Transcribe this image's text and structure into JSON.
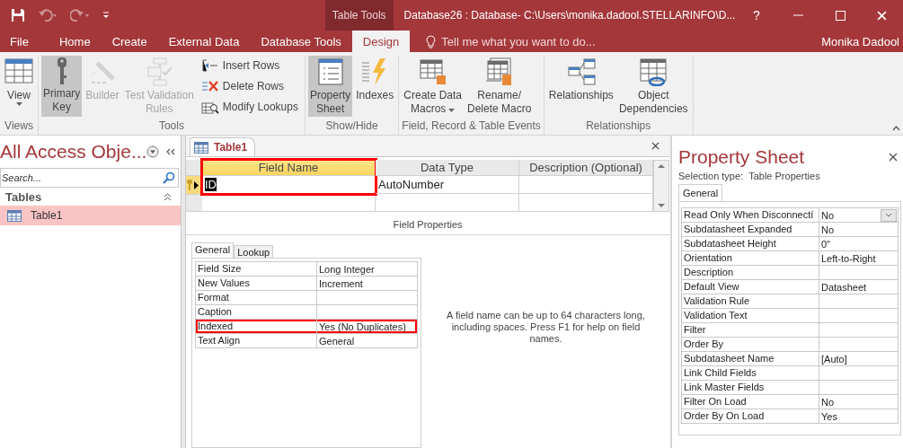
{
  "title_bar": {
    "context_tab": "Table Tools",
    "title": "Database26 : Database- C:\\Users\\monika.dadool.STELLARINFO\\D...",
    "help": "?"
  },
  "ribbon_tabs": [
    {
      "label": "File",
      "selected": false
    },
    {
      "label": "Home",
      "selected": false
    },
    {
      "label": "Create",
      "selected": false
    },
    {
      "label": "External Data",
      "selected": false
    },
    {
      "label": "Database Tools",
      "selected": false
    },
    {
      "label": "Design",
      "selected": true
    }
  ],
  "tell_me": {
    "placeholder": "Tell me what you want to do..."
  },
  "user": "Monika Dadool",
  "ribbon_groups": [
    {
      "label": "Views",
      "buttons": [
        {
          "kind": "large",
          "label": "View",
          "dropdown": true,
          "selected": false,
          "disabled": false
        }
      ]
    },
    {
      "label": "Tools",
      "buttons": [
        {
          "kind": "large",
          "label": "Primary\nKey",
          "dropdown": false,
          "selected": true,
          "disabled": false
        },
        {
          "kind": "large",
          "label": "Builder",
          "dropdown": false,
          "selected": false,
          "disabled": true
        },
        {
          "kind": "large",
          "label": "Test Validation\nRules",
          "dropdown": false,
          "selected": false,
          "disabled": true
        },
        {
          "kind": "small",
          "label": "Insert Rows",
          "disabled": false
        },
        {
          "kind": "small",
          "label": "Delete Rows",
          "disabled": false
        },
        {
          "kind": "small",
          "label": "Modify Lookups",
          "disabled": false
        }
      ]
    },
    {
      "label": "Show/Hide",
      "buttons": [
        {
          "kind": "large",
          "label": "Property\nSheet",
          "dropdown": false,
          "selected": true,
          "disabled": false
        },
        {
          "kind": "large",
          "label": "Indexes",
          "dropdown": false,
          "selected": false,
          "disabled": false
        }
      ]
    },
    {
      "label": "Field, Record & Table Events",
      "buttons": [
        {
          "kind": "large",
          "label": "Create Data\nMacros",
          "dropdown": true,
          "selected": false,
          "disabled": false
        },
        {
          "kind": "large",
          "label": "Rename/\nDelete Macro",
          "dropdown": false,
          "selected": false,
          "disabled": false
        }
      ]
    },
    {
      "label": "Relationships",
      "buttons": [
        {
          "kind": "large",
          "label": "Relationships",
          "dropdown": false,
          "selected": false,
          "disabled": false
        },
        {
          "kind": "large",
          "label": "Object\nDependencies",
          "dropdown": false,
          "selected": false,
          "disabled": false
        }
      ]
    }
  ],
  "nav_pane": {
    "title": "All Access Obje...",
    "search": {
      "placeholder": "Search..."
    },
    "groups": [
      {
        "label": "Tables",
        "expanded": true,
        "items": [
          {
            "label": "Table1",
            "selected": true
          }
        ]
      }
    ]
  },
  "document": {
    "tab": "Table1",
    "design_grid": {
      "columns": [
        {
          "label": "Field Name",
          "highlighted": true
        },
        {
          "label": "Data Type",
          "highlighted": false
        },
        {
          "label": "Description (Optional)",
          "highlighted": false
        }
      ],
      "rows": [
        {
          "cells": [
            "ID",
            "AutoNumber"
          ],
          "primary_key": true,
          "current": true,
          "selected": true
        }
      ]
    },
    "field_properties": {
      "label": "Field Properties",
      "tabs": [
        {
          "label": "General",
          "selected": true
        },
        {
          "label": "Lookup",
          "selected": false
        }
      ],
      "rows": [
        {
          "name": "Field Size",
          "value": "Long Integer",
          "highlighted": false
        },
        {
          "name": "New Values",
          "value": "Increment",
          "highlighted": false
        },
        {
          "name": "Format",
          "highlighted": false
        },
        {
          "name": "Caption",
          "highlighted": false
        },
        {
          "name": "Indexed",
          "value": "Yes (No Duplicates)",
          "highlighted": true
        },
        {
          "name": "Text Align",
          "value": "General",
          "highlighted": false
        }
      ],
      "help": "A field name can be up to 64 characters long, including spaces. Press F1 for help on field names."
    }
  },
  "property_sheet": {
    "title": "Property Sheet",
    "selection_label": "Selection type:",
    "selection_type": "Table Properties",
    "tab": "General",
    "rows": [
      {
        "name": "Read Only When Disconnectí",
        "value": "No",
        "dropdown": true
      },
      {
        "name": "Subdatasheet Expanded",
        "value": "No",
        "dropdown": false
      },
      {
        "name": "Subdatasheet Height",
        "value": "0\"",
        "dropdown": false
      },
      {
        "name": "Orientation",
        "value": "Left-to-Right",
        "dropdown": false
      },
      {
        "name": "Description",
        "dropdown": false
      },
      {
        "name": "Default View",
        "value": "Datasheet",
        "dropdown": false
      },
      {
        "name": "Validation Rule",
        "dropdown": false
      },
      {
        "name": "Validation Text",
        "dropdown": false
      },
      {
        "name": "Filter",
        "dropdown": false
      },
      {
        "name": "Order By",
        "dropdown": false
      },
      {
        "name": "Subdatasheet Name",
        "value": "[Auto]",
        "dropdown": false
      },
      {
        "name": "Link Child Fields",
        "dropdown": false
      },
      {
        "name": "Link Master Fields",
        "dropdown": false
      },
      {
        "name": "Filter On Load",
        "value": "No",
        "dropdown": false
      },
      {
        "name": "Order By On Load",
        "value": "Yes",
        "dropdown": false
      }
    ]
  }
}
